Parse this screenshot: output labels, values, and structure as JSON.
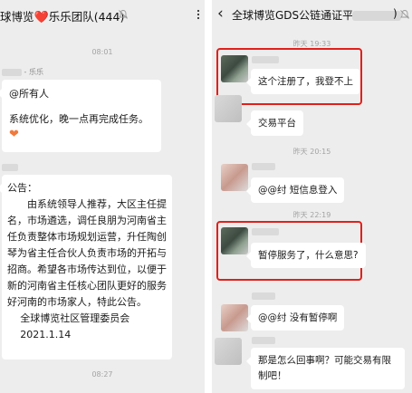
{
  "left": {
    "header": {
      "title_prefix": "球博览",
      "heart": "❤️",
      "title_suffix": "乐乐团队(444)"
    },
    "time1": "08:01",
    "msg1": {
      "sender_suffix": "- 乐乐",
      "mention": "@所有人",
      "text": "系统优化，晚一点再完成任务。",
      "emoji": "❤"
    },
    "msg2": {
      "title": "公告：",
      "body": "由系统领导人推荐，大区主任提名，市场遴选，调任良朋为河南省主任负责整体市场规划运营，升任陶创琴为省主任合伙人负责市场的开拓与招商。希望各市场传达到位，以便于新的河南省主任核心团队更好的服务好河南的市场家人，特此公告。",
      "sign1": "全球博览社区管理委员会",
      "sign2": "2021.1.14"
    },
    "time2": "08:27"
  },
  "right": {
    "header": {
      "back": "‹",
      "title": "全球博览GDS公链通证平",
      "title_end": ")"
    },
    "t1": "昨天 19:33",
    "m1": "这个注册了，我登不上",
    "m2": "交易平台",
    "t2": "昨天 20:15",
    "m3": "@@纣  短信息登入",
    "t3": "昨天 22:19",
    "m4": "暂停服务了，什么意思?",
    "m5": "@@纣  没有暂停啊",
    "m6": "那是怎么回事啊？可能交易有限制吧！",
    "colors": {
      "highlight": "#e0201b",
      "background": "#ededed"
    }
  }
}
